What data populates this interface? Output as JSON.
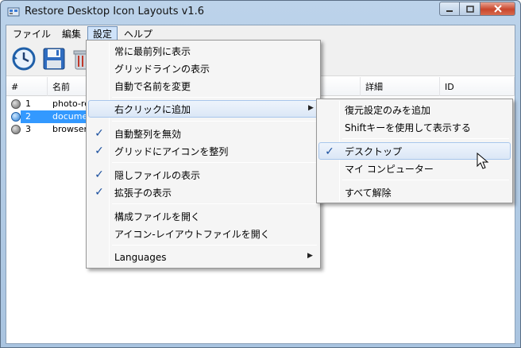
{
  "window": {
    "title": "Restore Desktop Icon Layouts v1.6"
  },
  "menubar": {
    "items": [
      "ファイル",
      "編集",
      "設定",
      "ヘルプ"
    ]
  },
  "listview": {
    "columns": [
      "#",
      "名前",
      "詳細",
      "ID"
    ],
    "rows": [
      {
        "num": "1",
        "name": "photo-ret",
        "selected": false
      },
      {
        "num": "2",
        "name": "document",
        "selected": true
      },
      {
        "num": "3",
        "name": "browsers",
        "selected": false
      }
    ]
  },
  "settings_menu": {
    "items": [
      {
        "label": "常に最前列に表示",
        "checked": false
      },
      {
        "label": "グリッドラインの表示",
        "checked": false
      },
      {
        "label": "自動で名前を変更",
        "checked": false
      },
      {
        "label": "右クリックに追加",
        "checked": false,
        "submenu": true
      },
      {
        "label": "自動整列を無効",
        "checked": true
      },
      {
        "label": "グリッドにアイコンを整列",
        "checked": true
      },
      {
        "label": "隠しファイルの表示",
        "checked": true
      },
      {
        "label": "拡張子の表示",
        "checked": true
      },
      {
        "label": "構成ファイルを開く",
        "checked": false
      },
      {
        "label": "アイコン-レイアウトファイルを開く",
        "checked": false
      },
      {
        "label": "Languages",
        "checked": false,
        "submenu": true
      }
    ]
  },
  "submenu": {
    "items": [
      {
        "label": "復元設定のみを追加",
        "checked": false
      },
      {
        "label": "Shiftキーを使用して表示する",
        "checked": false
      },
      {
        "label": "デスクトップ",
        "checked": true
      },
      {
        "label": "マイ コンピューター",
        "checked": false
      },
      {
        "label": "すべて解除",
        "checked": false
      }
    ]
  },
  "icons": {
    "app": "app-icon",
    "restore": "restore-clock-icon",
    "save": "save-disk-icon",
    "delete": "trash-icon",
    "check": "✓",
    "arrow": "▶"
  },
  "colors": {
    "accent": "#3399ff",
    "check": "#1a4f9e",
    "close": "#c9462c"
  }
}
